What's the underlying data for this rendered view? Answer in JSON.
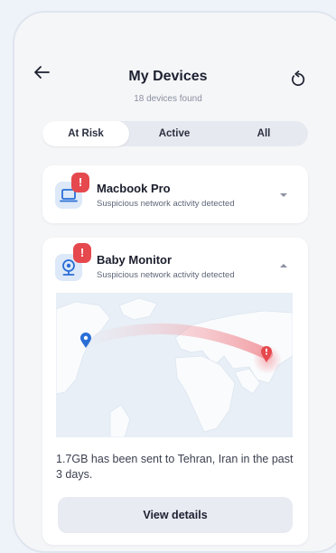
{
  "header": {
    "title": "My Devices",
    "subtitle": "18 devices found",
    "back_icon": "arrow-left-icon",
    "refresh_icon": "refresh-icon"
  },
  "tabs": [
    {
      "label": "At Risk",
      "selected": true
    },
    {
      "label": "Active",
      "selected": false
    },
    {
      "label": "All",
      "selected": false
    }
  ],
  "devices": [
    {
      "name": "Macbook Pro",
      "status": "Suspicious network activity detected",
      "icon": "laptop-icon",
      "badge": "!",
      "expanded": false
    },
    {
      "name": "Baby Monitor",
      "status": "Suspicious network activity detected",
      "icon": "webcam-icon",
      "badge": "!",
      "expanded": true,
      "message": "1.7GB has been sent to Tehran, Iran in the past 3 days.",
      "button_label": "View details"
    }
  ],
  "colors": {
    "accent_blue": "#2a6fd6",
    "alert_red": "#e5484d",
    "background": "#f5f6f8"
  }
}
